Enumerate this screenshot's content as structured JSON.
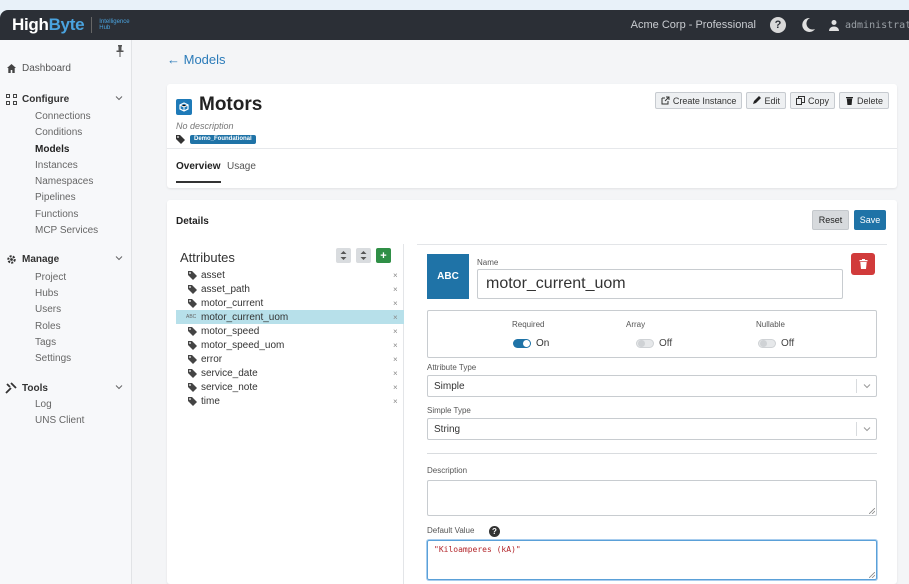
{
  "brand": {
    "name_a": "High",
    "name_b": "Byte",
    "sub": "Intelligence Hub"
  },
  "topbar": {
    "org": "Acme Corp - Professional",
    "user": "administrator"
  },
  "sidebar": {
    "dashboard": "Dashboard",
    "configure": "Configure",
    "configure_items": [
      "Connections",
      "Conditions",
      "Models",
      "Instances",
      "Namespaces",
      "Pipelines",
      "Functions",
      "MCP Services"
    ],
    "manage": "Manage",
    "manage_items": [
      "Project",
      "Hubs",
      "Users",
      "Roles",
      "Tags",
      "Settings"
    ],
    "tools": "Tools",
    "tools_items": [
      "Log",
      "UNS Client"
    ]
  },
  "back_link": "← Models",
  "model": {
    "title": "Motors",
    "description": "No description",
    "tag": "Demo_Foundational",
    "actions": {
      "create_instance": "Create Instance",
      "edit": "Edit",
      "copy": "Copy",
      "delete": "Delete"
    },
    "tabs": [
      "Overview",
      "Usage"
    ]
  },
  "details": {
    "title": "Details",
    "reset": "Reset",
    "save": "Save",
    "attributes_heading": "Attributes",
    "attributes": [
      "asset",
      "asset_path",
      "motor_current",
      "motor_current_uom",
      "motor_speed",
      "motor_speed_uom",
      "error",
      "service_date",
      "service_note",
      "time"
    ],
    "selected_index": 3,
    "remove_symbol": "×"
  },
  "editor": {
    "type_badge": "ABC",
    "mini_badge": "ABC",
    "name_label": "Name",
    "name_value": "motor_current_uom",
    "required_label": "Required",
    "required_state": "On",
    "array_label": "Array",
    "array_state": "Off",
    "nullable_label": "Nullable",
    "nullable_state": "Off",
    "attribute_type_label": "Attribute Type",
    "attribute_type_value": "Simple",
    "simple_type_label": "Simple Type",
    "simple_type_value": "String",
    "description_label": "Description",
    "description_value": "",
    "default_value_label": "Default Value",
    "default_value": "\"Kiloamperes (kA)\""
  },
  "colors": {
    "accent": "#1f73a7",
    "topbar": "#2b2f36",
    "danger": "#d13b3b",
    "add": "#2f8f46",
    "selected_row": "#b7e0ea"
  }
}
